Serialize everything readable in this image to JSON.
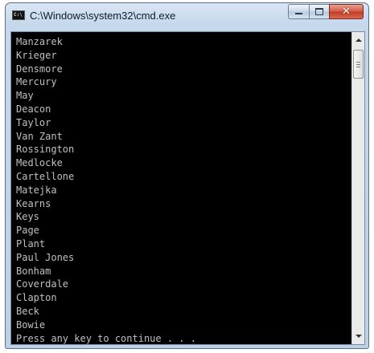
{
  "window": {
    "title": "C:\\Windows\\system32\\cmd.exe",
    "app_icon_text": "C:\\",
    "buttons": {
      "minimize": "minimize",
      "maximize": "maximize",
      "close": "✕"
    }
  },
  "console": {
    "lines": [
      "Manzarek",
      "Krieger",
      "Densmore",
      "Mercury",
      "May",
      "Deacon",
      "Taylor",
      "Van Zant",
      "Rossington",
      "Medlocke",
      "Cartellone",
      "Matejka",
      "Kearns",
      "Keys",
      "Page",
      "Plant",
      "Paul Jones",
      "Bonham",
      "Coverdale",
      "Clapton",
      "Beck",
      "Bowie",
      "Press any key to continue . . ."
    ]
  },
  "colors": {
    "console_background": "#000000",
    "console_text": "#c0c0c0",
    "close_button": "#c8432c",
    "titlebar": "#c6d8ec"
  },
  "icons": {
    "app": "console-icon",
    "minimize": "minimize-icon",
    "maximize": "maximize-icon",
    "close": "close-icon",
    "scroll_up": "scroll-up-arrow-icon",
    "scroll_down": "scroll-down-arrow-icon"
  }
}
